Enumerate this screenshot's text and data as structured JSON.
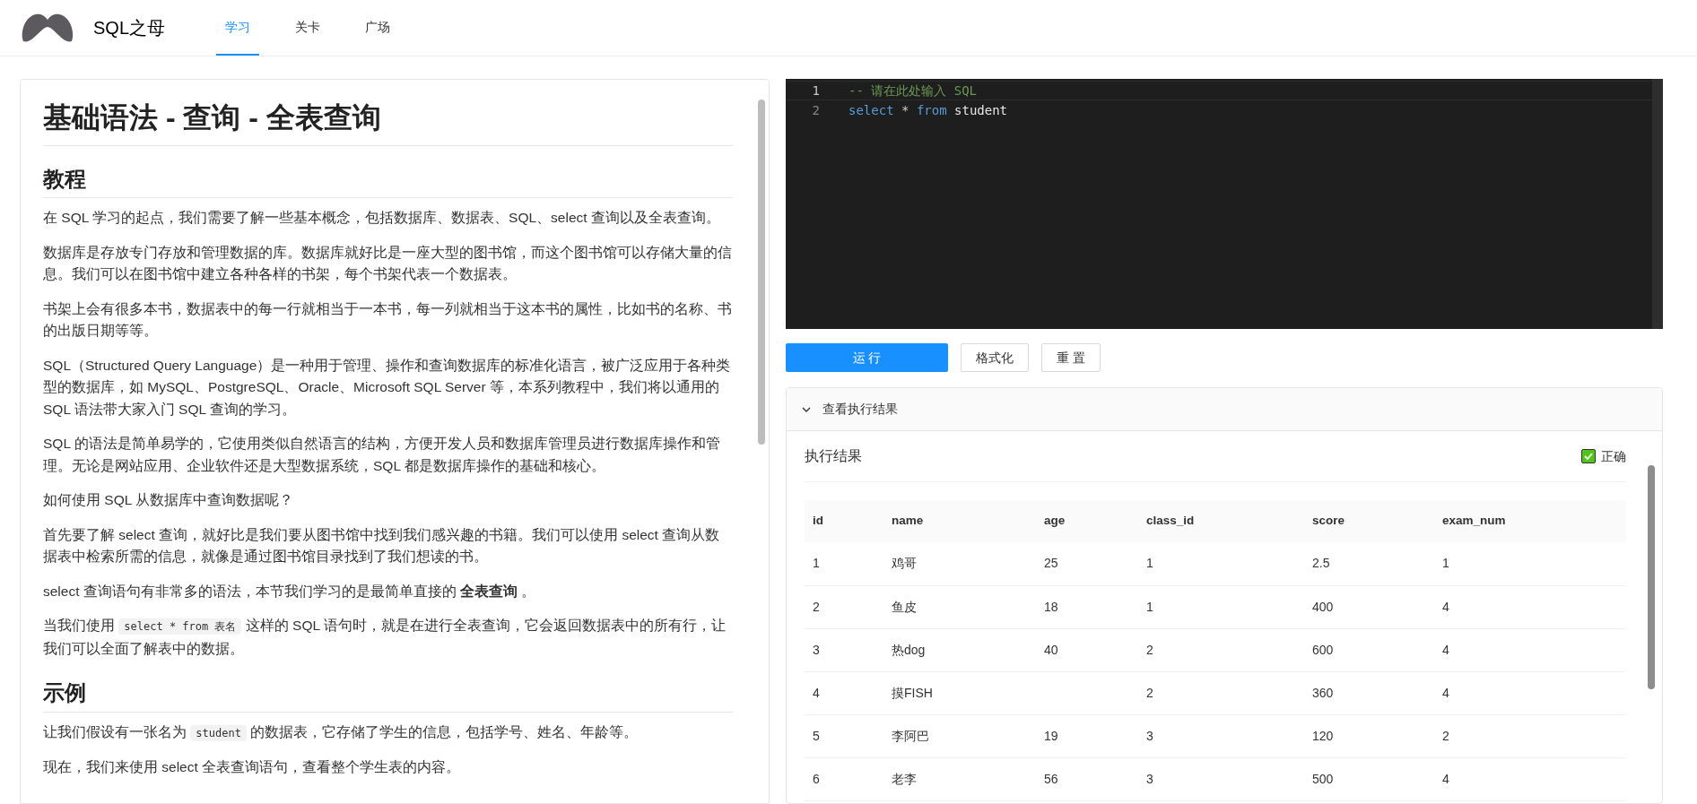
{
  "header": {
    "brand": "SQL之母",
    "tabs": [
      {
        "label": "学习",
        "selected": true
      },
      {
        "label": "关卡",
        "selected": false
      },
      {
        "label": "广场",
        "selected": false
      }
    ]
  },
  "lesson": {
    "title": "基础语法 - 查询 - 全表查询",
    "sections": [
      {
        "heading": "教程",
        "paragraphs": [
          [
            {
              "kind": "text",
              "text": "在 SQL 学习的起点，我们需要了解一些基本概念，包括数据库、数据表、SQL、select 查询以及全表查询。"
            }
          ],
          [
            {
              "kind": "text",
              "text": "数据库是存放专门存放和管理数据的库。数据库就好比是一座大型的图书馆，而这个图书馆可以存储大量的信息。我们可以在图书馆中建立各种各样的书架，每个书架代表一个数据表。"
            }
          ],
          [
            {
              "kind": "text",
              "text": "书架上会有很多本书，数据表中的每一行就相当于一本书，每一列就相当于这本书的属性，比如书的名称、书的出版日期等等。"
            }
          ],
          [
            {
              "kind": "text",
              "text": "SQL（Structured Query Language）是一种用于管理、操作和查询数据库的标准化语言，被广泛应用于各种类型的数据库，如 MySQL、PostgreSQL、Oracle、Microsoft SQL Server 等，本系列教程中，我们将以通用的 SQL 语法带大家入门 SQL 查询的学习。"
            }
          ],
          [
            {
              "kind": "text",
              "text": "SQL 的语法是简单易学的，它使用类似自然语言的结构，方便开发人员和数据库管理员进行数据库操作和管理。无论是网站应用、企业软件还是大型数据系统，SQL 都是数据库操作的基础和核心。"
            }
          ],
          [
            {
              "kind": "text",
              "text": "如何使用 SQL 从数据库中查询数据呢？"
            }
          ],
          [
            {
              "kind": "text",
              "text": "首先要了解 select 查询，就好比是我们要从图书馆中找到我们感兴趣的书籍。我们可以使用 select 查询从数据表中检索所需的信息，就像是通过图书馆目录找到了我们想读的书。"
            }
          ],
          [
            {
              "kind": "text",
              "text": "select 查询语句有非常多的语法，本节我们学习的是最简单直接的 **全表查询** 。"
            }
          ],
          [
            {
              "kind": "text",
              "text": "当我们使用 "
            },
            {
              "kind": "code",
              "text": "select * from 表名"
            },
            {
              "kind": "text",
              "text": " 这样的 SQL 语句时，就是在进行全表查询，它会返回数据表中的所有行，让我们可以全面了解表中的数据。"
            }
          ]
        ]
      },
      {
        "heading": "示例",
        "paragraphs": [
          [
            {
              "kind": "text",
              "text": "让我们假设有一张名为 "
            },
            {
              "kind": "code",
              "text": "student"
            },
            {
              "kind": "text",
              "text": " 的数据表，它存储了学生的信息，包括学号、姓名、年龄等。"
            }
          ],
          [
            {
              "kind": "text",
              "text": "现在，我们来使用 select 全表查询语句，查看整个学生表的内容。"
            }
          ]
        ]
      }
    ]
  },
  "editor": {
    "lines": [
      {
        "number": "1",
        "tokens": [
          {
            "kind": "comment",
            "text": "-- 请在此处输入 SQL"
          }
        ]
      },
      {
        "number": "2",
        "tokens": [
          {
            "kind": "keyword",
            "text": "select"
          },
          {
            "kind": "operator",
            "text": " * "
          },
          {
            "kind": "keyword",
            "text": "from"
          },
          {
            "kind": "plain",
            "text": " student"
          }
        ]
      }
    ]
  },
  "buttons": [
    {
      "label": "运 行",
      "kind": "primary"
    },
    {
      "label": "格式化",
      "kind": "default"
    },
    {
      "label": "重 置",
      "kind": "default"
    }
  ],
  "result_panel": {
    "title": "查看执行结果",
    "expanded": true,
    "card_title": "执行结果",
    "correct": {
      "checked": true,
      "label": "正确"
    },
    "table": {
      "columns": [
        "id",
        "name",
        "age",
        "class_id",
        "score",
        "exam_num"
      ],
      "rows": [
        [
          "1",
          "鸡哥",
          "25",
          "1",
          "2.5",
          "1"
        ],
        [
          "2",
          "鱼皮",
          "18",
          "1",
          "400",
          "4"
        ],
        [
          "3",
          "热dog",
          "40",
          "2",
          "600",
          "4"
        ],
        [
          "4",
          "摸FISH",
          "",
          "2",
          "360",
          "4"
        ],
        [
          "5",
          "李阿巴",
          "19",
          "3",
          "120",
          "2"
        ],
        [
          "6",
          "老李",
          "56",
          "3",
          "500",
          "4"
        ]
      ]
    }
  }
}
